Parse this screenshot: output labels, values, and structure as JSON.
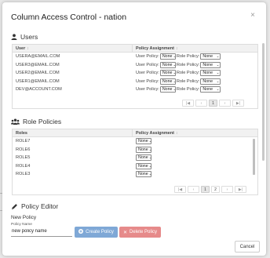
{
  "dialog": {
    "title": "Column Access Control - nation",
    "close_icon": "close-icon"
  },
  "users": {
    "title": "Users",
    "icon": "user-icon",
    "columns": {
      "user": "User",
      "policy": "Policy Assignment"
    },
    "rows": [
      {
        "user": "USERA@EMAIL.COM",
        "user_policy_label": "User Policy:",
        "user_policy": "None",
        "role_policy_label": "Role Policy:",
        "role_policy": "None"
      },
      {
        "user": "USER3@EMAIL.COM",
        "user_policy_label": "User Policy:",
        "user_policy": "None",
        "role_policy_label": "Role Policy:",
        "role_policy": "None"
      },
      {
        "user": "USER2@EMAIL.COM",
        "user_policy_label": "User Policy:",
        "user_policy": "None",
        "role_policy_label": "Role Policy:",
        "role_policy": "None"
      },
      {
        "user": "USER1@EMAIL.COM",
        "user_policy_label": "User Policy:",
        "user_policy": "None",
        "role_policy_label": "Role Policy:",
        "role_policy": "None"
      },
      {
        "user": "DEV@ACCOUNT.COM",
        "user_policy_label": "User Policy:",
        "user_policy": "None",
        "role_policy_label": "Role Policy:",
        "role_policy": "None"
      }
    ],
    "pager": {
      "current_page": "1"
    }
  },
  "roles": {
    "title": "Role Policies",
    "icon": "users-group-icon",
    "columns": {
      "role": "Roles",
      "policy": "Policy Assignment"
    },
    "rows": [
      {
        "role": "ROLE7",
        "policy": "None"
      },
      {
        "role": "ROLE6",
        "policy": "None"
      },
      {
        "role": "ROLE5",
        "policy": "None"
      },
      {
        "role": "ROLE4",
        "policy": "None"
      },
      {
        "role": "ROLE3",
        "policy": "None"
      }
    ],
    "pager": {
      "pages": [
        "1",
        "2"
      ],
      "current_page": "1"
    }
  },
  "editor": {
    "title": "Policy Editor",
    "icon": "pencil-icon",
    "subtitle": "New Policy",
    "name_label": "Policy Name",
    "name_value": "new policy name",
    "create_label": "Create Policy",
    "delete_label": "Delete Policy"
  },
  "footer": {
    "cancel_label": "Cancel"
  },
  "colors": {
    "create_button": "#7fa8d6",
    "delete_button": "#e68a8a"
  }
}
